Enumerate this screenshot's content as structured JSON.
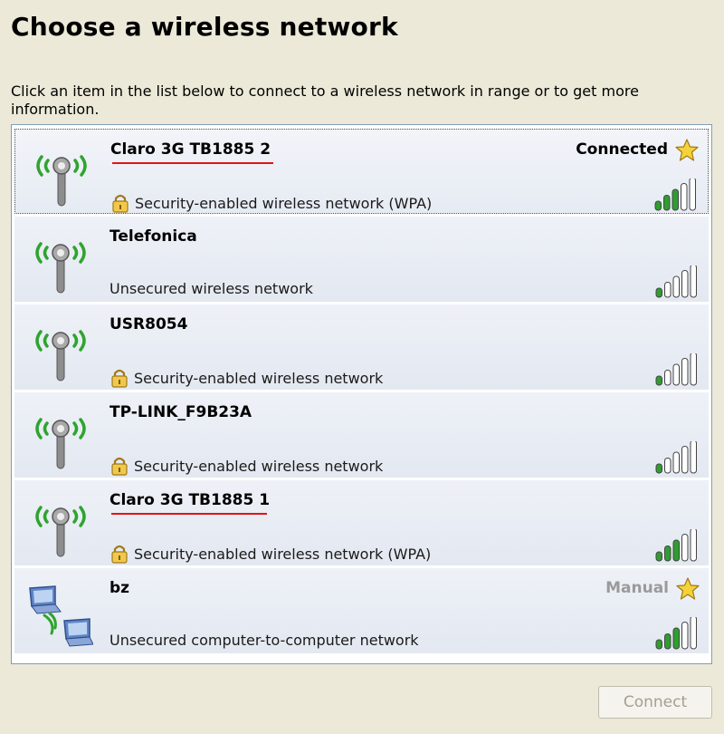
{
  "header": {
    "title": "Choose a wireless network",
    "description": "Click an item in the list below to connect to a wireless network in range or to get more information."
  },
  "networks": [
    {
      "name": "Claro 3G TB1885 2",
      "security": "Security-enabled wireless network (WPA)",
      "status": "Connected",
      "secured": true,
      "signal_bars": 5,
      "signal_strong": 3,
      "underlined": true,
      "selected": true,
      "type": "infrastructure"
    },
    {
      "name": "Telefonica",
      "security": "Unsecured wireless network",
      "status": "",
      "secured": false,
      "signal_bars": 5,
      "signal_strong": 1,
      "underlined": false,
      "selected": false,
      "type": "infrastructure"
    },
    {
      "name": "USR8054",
      "security": "Security-enabled wireless network",
      "status": "",
      "secured": true,
      "signal_bars": 5,
      "signal_strong": 1,
      "underlined": false,
      "selected": false,
      "type": "infrastructure"
    },
    {
      "name": "TP-LINK_F9B23A",
      "security": "Security-enabled wireless network",
      "status": "",
      "secured": true,
      "signal_bars": 5,
      "signal_strong": 1,
      "underlined": false,
      "selected": false,
      "type": "infrastructure"
    },
    {
      "name": "Claro 3G TB1885 1",
      "security": "Security-enabled wireless network (WPA)",
      "status": "",
      "secured": true,
      "signal_bars": 5,
      "signal_strong": 3,
      "underlined": true,
      "selected": false,
      "type": "infrastructure"
    },
    {
      "name": "bz",
      "security": "Unsecured computer-to-computer network",
      "status": "Manual",
      "secured": false,
      "signal_bars": 5,
      "signal_strong": 3,
      "underlined": false,
      "selected": false,
      "type": "ad-hoc"
    }
  ],
  "icons": {
    "infrastructure": "antenna-icon",
    "adhoc": "computer-to-computer-icon",
    "lock": "lock-icon",
    "star": "star-icon",
    "signal": "signal-strength-icon"
  },
  "colors": {
    "background": "#ece9d8",
    "row": "#e3e8f1",
    "signal_active": "#2f9e2f",
    "underline": "#e0141e",
    "manual": "#9a9a9a"
  },
  "footer": {
    "connect_label": "Connect",
    "connect_enabled": false
  }
}
